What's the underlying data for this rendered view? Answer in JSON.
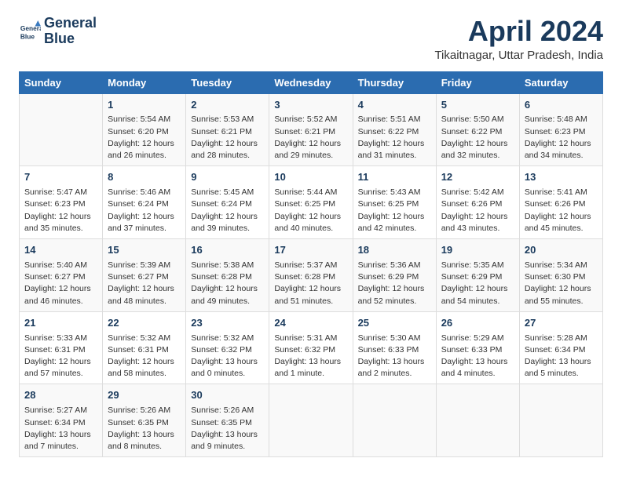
{
  "header": {
    "logo_line1": "General",
    "logo_line2": "Blue",
    "title": "April 2024",
    "subtitle": "Tikaitnagar, Uttar Pradesh, India"
  },
  "columns": [
    "Sunday",
    "Monday",
    "Tuesday",
    "Wednesday",
    "Thursday",
    "Friday",
    "Saturday"
  ],
  "weeks": [
    {
      "cells": [
        {
          "day": "",
          "info": ""
        },
        {
          "day": "1",
          "info": "Sunrise: 5:54 AM\nSunset: 6:20 PM\nDaylight: 12 hours\nand 26 minutes."
        },
        {
          "day": "2",
          "info": "Sunrise: 5:53 AM\nSunset: 6:21 PM\nDaylight: 12 hours\nand 28 minutes."
        },
        {
          "day": "3",
          "info": "Sunrise: 5:52 AM\nSunset: 6:21 PM\nDaylight: 12 hours\nand 29 minutes."
        },
        {
          "day": "4",
          "info": "Sunrise: 5:51 AM\nSunset: 6:22 PM\nDaylight: 12 hours\nand 31 minutes."
        },
        {
          "day": "5",
          "info": "Sunrise: 5:50 AM\nSunset: 6:22 PM\nDaylight: 12 hours\nand 32 minutes."
        },
        {
          "day": "6",
          "info": "Sunrise: 5:48 AM\nSunset: 6:23 PM\nDaylight: 12 hours\nand 34 minutes."
        }
      ]
    },
    {
      "cells": [
        {
          "day": "7",
          "info": "Sunrise: 5:47 AM\nSunset: 6:23 PM\nDaylight: 12 hours\nand 35 minutes."
        },
        {
          "day": "8",
          "info": "Sunrise: 5:46 AM\nSunset: 6:24 PM\nDaylight: 12 hours\nand 37 minutes."
        },
        {
          "day": "9",
          "info": "Sunrise: 5:45 AM\nSunset: 6:24 PM\nDaylight: 12 hours\nand 39 minutes."
        },
        {
          "day": "10",
          "info": "Sunrise: 5:44 AM\nSunset: 6:25 PM\nDaylight: 12 hours\nand 40 minutes."
        },
        {
          "day": "11",
          "info": "Sunrise: 5:43 AM\nSunset: 6:25 PM\nDaylight: 12 hours\nand 42 minutes."
        },
        {
          "day": "12",
          "info": "Sunrise: 5:42 AM\nSunset: 6:26 PM\nDaylight: 12 hours\nand 43 minutes."
        },
        {
          "day": "13",
          "info": "Sunrise: 5:41 AM\nSunset: 6:26 PM\nDaylight: 12 hours\nand 45 minutes."
        }
      ]
    },
    {
      "cells": [
        {
          "day": "14",
          "info": "Sunrise: 5:40 AM\nSunset: 6:27 PM\nDaylight: 12 hours\nand 46 minutes."
        },
        {
          "day": "15",
          "info": "Sunrise: 5:39 AM\nSunset: 6:27 PM\nDaylight: 12 hours\nand 48 minutes."
        },
        {
          "day": "16",
          "info": "Sunrise: 5:38 AM\nSunset: 6:28 PM\nDaylight: 12 hours\nand 49 minutes."
        },
        {
          "day": "17",
          "info": "Sunrise: 5:37 AM\nSunset: 6:28 PM\nDaylight: 12 hours\nand 51 minutes."
        },
        {
          "day": "18",
          "info": "Sunrise: 5:36 AM\nSunset: 6:29 PM\nDaylight: 12 hours\nand 52 minutes."
        },
        {
          "day": "19",
          "info": "Sunrise: 5:35 AM\nSunset: 6:29 PM\nDaylight: 12 hours\nand 54 minutes."
        },
        {
          "day": "20",
          "info": "Sunrise: 5:34 AM\nSunset: 6:30 PM\nDaylight: 12 hours\nand 55 minutes."
        }
      ]
    },
    {
      "cells": [
        {
          "day": "21",
          "info": "Sunrise: 5:33 AM\nSunset: 6:31 PM\nDaylight: 12 hours\nand 57 minutes."
        },
        {
          "day": "22",
          "info": "Sunrise: 5:32 AM\nSunset: 6:31 PM\nDaylight: 12 hours\nand 58 minutes."
        },
        {
          "day": "23",
          "info": "Sunrise: 5:32 AM\nSunset: 6:32 PM\nDaylight: 13 hours\nand 0 minutes."
        },
        {
          "day": "24",
          "info": "Sunrise: 5:31 AM\nSunset: 6:32 PM\nDaylight: 13 hours\nand 1 minute."
        },
        {
          "day": "25",
          "info": "Sunrise: 5:30 AM\nSunset: 6:33 PM\nDaylight: 13 hours\nand 2 minutes."
        },
        {
          "day": "26",
          "info": "Sunrise: 5:29 AM\nSunset: 6:33 PM\nDaylight: 13 hours\nand 4 minutes."
        },
        {
          "day": "27",
          "info": "Sunrise: 5:28 AM\nSunset: 6:34 PM\nDaylight: 13 hours\nand 5 minutes."
        }
      ]
    },
    {
      "cells": [
        {
          "day": "28",
          "info": "Sunrise: 5:27 AM\nSunset: 6:34 PM\nDaylight: 13 hours\nand 7 minutes."
        },
        {
          "day": "29",
          "info": "Sunrise: 5:26 AM\nSunset: 6:35 PM\nDaylight: 13 hours\nand 8 minutes."
        },
        {
          "day": "30",
          "info": "Sunrise: 5:26 AM\nSunset: 6:35 PM\nDaylight: 13 hours\nand 9 minutes."
        },
        {
          "day": "",
          "info": ""
        },
        {
          "day": "",
          "info": ""
        },
        {
          "day": "",
          "info": ""
        },
        {
          "day": "",
          "info": ""
        }
      ]
    }
  ]
}
